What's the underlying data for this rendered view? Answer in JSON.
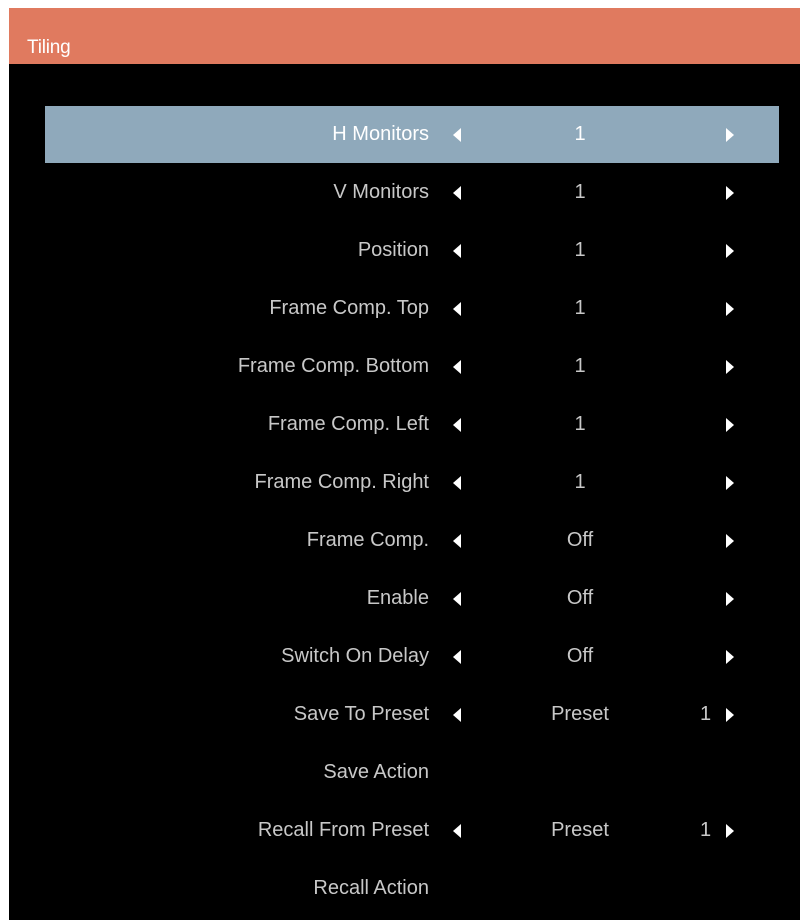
{
  "window": {
    "title": "Tiling"
  },
  "menu": {
    "items": [
      {
        "label": "H Monitors",
        "value": "1",
        "selected": true
      },
      {
        "label": "V Monitors",
        "value": "1"
      },
      {
        "label": "Position",
        "value": "1"
      },
      {
        "label": "Frame Comp. Top",
        "value": "1"
      },
      {
        "label": "Frame Comp. Bottom",
        "value": "1"
      },
      {
        "label": "Frame Comp. Left",
        "value": "1"
      },
      {
        "label": "Frame Comp. Right",
        "value": "1"
      },
      {
        "label": "Frame Comp.",
        "value": "Off"
      },
      {
        "label": "Enable",
        "value": "Off"
      },
      {
        "label": "Switch On Delay",
        "value": "Off"
      },
      {
        "label": "Save To Preset",
        "value": "Preset",
        "number": "1"
      },
      {
        "label": "Save Action"
      },
      {
        "label": "Recall From Preset",
        "value": "Preset",
        "number": "1"
      },
      {
        "label": "Recall Action"
      }
    ]
  },
  "colors": {
    "titlebar": "#e07a5f",
    "background": "#000000",
    "selection": "#8fa9bb",
    "text": "#c8c8c8"
  },
  "icons": {
    "left": "arrow-left-icon",
    "right": "arrow-right-icon"
  }
}
